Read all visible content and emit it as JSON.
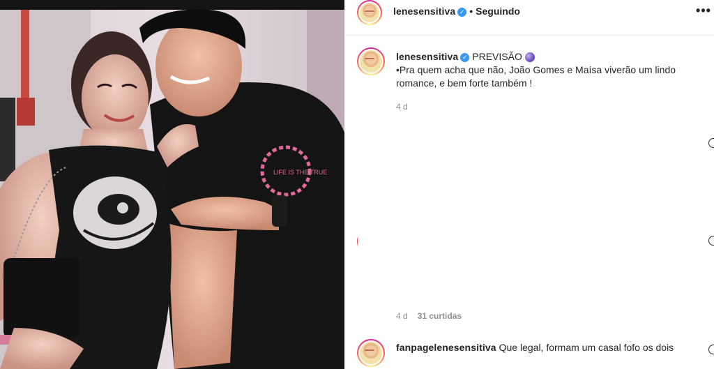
{
  "post": {
    "username": "lenesensitiva",
    "verified_mark": "✓",
    "dot": "•",
    "follow_status": "Seguindo",
    "more_label": "•••",
    "caption_tag": "PREVISÃO",
    "caption_icon": "crystal-ball-icon",
    "caption_line1": "•Pra quem acha que não, João Gomes e Maísa viverão um lindo",
    "caption_line2": "romance, e bem forte também !",
    "caption_age": "4 d"
  },
  "reply": {
    "age": "4 d",
    "likes": "31 curtidas"
  },
  "comment": {
    "username": "fanpagelenesensitiva",
    "text": "Que legal, formam um casal fofo os dois"
  },
  "photo": {
    "shirt_print": "LIFE IS THE TRUE"
  },
  "colors": {
    "verified": "#3897f0",
    "meta_gray": "#8e8e8e",
    "text": "#262626"
  }
}
